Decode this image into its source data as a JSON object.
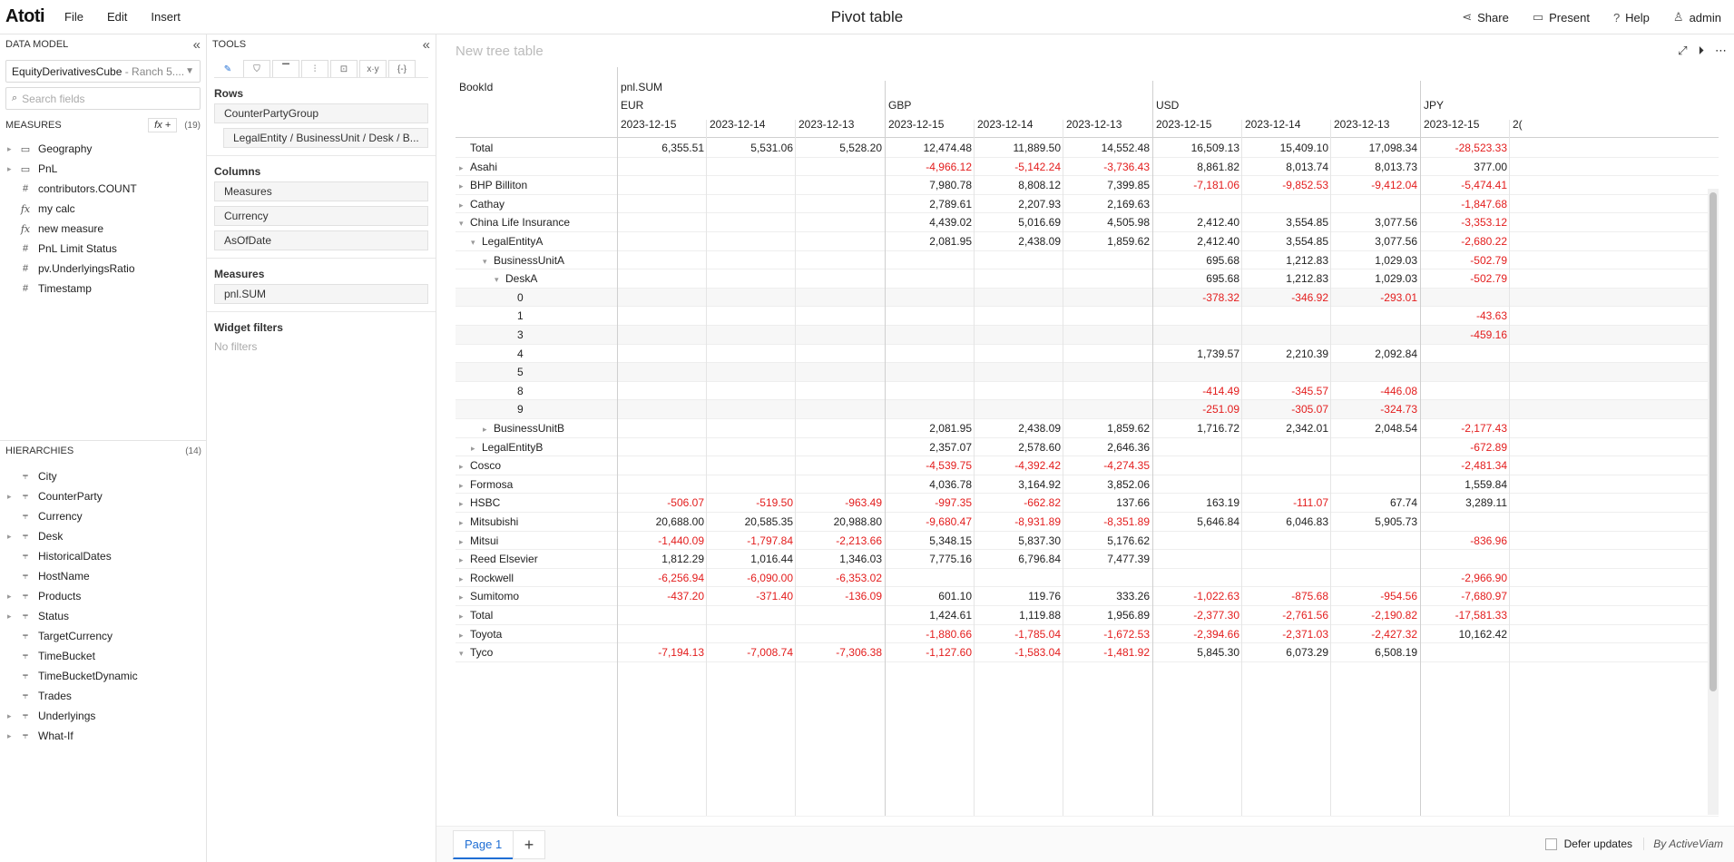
{
  "app": {
    "logo": "Atoti",
    "menu": [
      "File",
      "Edit",
      "Insert"
    ],
    "title": "Pivot table",
    "actions": [
      {
        "label": "Share",
        "icon": "share-icon"
      },
      {
        "label": "Present",
        "icon": "monitor-icon"
      },
      {
        "label": "Help",
        "icon": "help-icon"
      },
      {
        "label": "admin",
        "icon": "user-icon"
      }
    ]
  },
  "data_model": {
    "header": "DATA MODEL",
    "cube": "EquityDerivativesCube",
    "cube_suffix": " - Ranch 5....",
    "search_placeholder": "Search fields",
    "measures_header": "MEASURES",
    "measures_fx": "fx",
    "measures_count": "(19)",
    "measures": [
      {
        "label": "Geography",
        "icon": "folder-icon",
        "caret": true
      },
      {
        "label": "PnL",
        "icon": "folder-icon",
        "caret": true
      },
      {
        "label": "contributors.COUNT",
        "icon": "hash-icon"
      },
      {
        "label": "my calc",
        "icon": "fx-icon"
      },
      {
        "label": "new measure",
        "icon": "fx-icon"
      },
      {
        "label": "PnL Limit Status",
        "icon": "hash-icon"
      },
      {
        "label": "pv.UnderlyingsRatio",
        "icon": "hash-icon"
      },
      {
        "label": "Timestamp",
        "icon": "hash-icon"
      }
    ],
    "hierarchies_header": "HIERARCHIES",
    "hierarchies_count": "(14)",
    "hierarchies": [
      {
        "label": "City",
        "caret": false
      },
      {
        "label": "CounterParty",
        "caret": true
      },
      {
        "label": "Currency",
        "caret": false
      },
      {
        "label": "Desk",
        "caret": true
      },
      {
        "label": "HistoricalDates",
        "caret": false
      },
      {
        "label": "HostName",
        "caret": false
      },
      {
        "label": "Products",
        "caret": true
      },
      {
        "label": "Status",
        "caret": true
      },
      {
        "label": "TargetCurrency",
        "caret": false
      },
      {
        "label": "TimeBucket",
        "caret": false
      },
      {
        "label": "TimeBucketDynamic",
        "caret": false
      },
      {
        "label": "Trades",
        "caret": false
      },
      {
        "label": "Underlyings",
        "caret": true
      },
      {
        "label": "What-If",
        "caret": true
      }
    ]
  },
  "tools": {
    "header": "TOOLS",
    "tabs": [
      "pencil-icon",
      "filter-icon",
      "paint-roller-icon",
      "sliders-icon",
      "formula-icon",
      "xy-icon",
      "braces-icon"
    ],
    "tab_glyphs": [
      "✎",
      "⛉",
      "▔",
      "⫶",
      "⊡",
      "x·y",
      "{-}"
    ],
    "rows_title": "Rows",
    "rows": [
      "CounterPartyGroup",
      "LegalEntity / BusinessUnit / Desk / B..."
    ],
    "columns_title": "Columns",
    "columns": [
      "Measures",
      "Currency",
      "AsOfDate"
    ],
    "measures_title": "Measures",
    "measures": [
      "pnl.SUM"
    ],
    "filters_title": "Widget filters",
    "filters_empty": "No filters"
  },
  "widget": {
    "title": "New tree table",
    "row_header": "BookId",
    "measure": "pnl.SUM",
    "currencies": [
      "EUR",
      "GBP",
      "USD",
      "JPY"
    ],
    "dates": [
      "2023-12-15",
      "2023-12-14",
      "2023-12-13",
      "2023-12-15",
      "2023-12-14",
      "2023-12-13",
      "2023-12-15",
      "2023-12-14",
      "2023-12-13",
      "2023-12-15",
      "2("
    ],
    "rows": [
      {
        "label": "Total",
        "level": 0,
        "toggle": "",
        "values": [
          "6,355.51",
          "5,531.06",
          "5,528.20",
          "12,474.48",
          "11,889.50",
          "14,552.48",
          "16,509.13",
          "15,409.10",
          "17,098.34",
          "-28,523.33"
        ]
      },
      {
        "label": "Asahi",
        "level": 0,
        "toggle": "▸",
        "values": [
          "",
          "",
          "",
          "-4,966.12",
          "-5,142.24",
          "-3,736.43",
          "8,861.82",
          "8,013.74",
          "8,013.73",
          "377.00"
        ]
      },
      {
        "label": "BHP Billiton",
        "level": 0,
        "toggle": "▸",
        "values": [
          "",
          "",
          "",
          "7,980.78",
          "8,808.12",
          "7,399.85",
          "-7,181.06",
          "-9,852.53",
          "-9,412.04",
          "-5,474.41"
        ]
      },
      {
        "label": "Cathay",
        "level": 0,
        "toggle": "▸",
        "values": [
          "",
          "",
          "",
          "2,789.61",
          "2,207.93",
          "2,169.63",
          "",
          "",
          "",
          "-1,847.68"
        ]
      },
      {
        "label": "China Life Insurance",
        "level": 0,
        "toggle": "▾",
        "values": [
          "",
          "",
          "",
          "4,439.02",
          "5,016.69",
          "4,505.98",
          "2,412.40",
          "3,554.85",
          "3,077.56",
          "-3,353.12"
        ]
      },
      {
        "label": "LegalEntityA",
        "level": 1,
        "toggle": "▾",
        "values": [
          "",
          "",
          "",
          "2,081.95",
          "2,438.09",
          "1,859.62",
          "2,412.40",
          "3,554.85",
          "3,077.56",
          "-2,680.22"
        ]
      },
      {
        "label": "BusinessUnitA",
        "level": 2,
        "toggle": "▾",
        "values": [
          "",
          "",
          "",
          "",
          "",
          "",
          "695.68",
          "1,212.83",
          "1,029.03",
          "-502.79"
        ]
      },
      {
        "label": "DeskA",
        "level": 3,
        "toggle": "▾",
        "values": [
          "",
          "",
          "",
          "",
          "",
          "",
          "695.68",
          "1,212.83",
          "1,029.03",
          "-502.79"
        ]
      },
      {
        "label": "0",
        "level": 4,
        "toggle": "",
        "values": [
          "",
          "",
          "",
          "",
          "",
          "",
          "-378.32",
          "-346.92",
          "-293.01",
          ""
        ]
      },
      {
        "label": "1",
        "level": 4,
        "toggle": "",
        "values": [
          "",
          "",
          "",
          "",
          "",
          "",
          "",
          "",
          "",
          "-43.63"
        ]
      },
      {
        "label": "3",
        "level": 4,
        "toggle": "",
        "values": [
          "",
          "",
          "",
          "",
          "",
          "",
          "",
          "",
          "",
          "-459.16"
        ]
      },
      {
        "label": "4",
        "level": 4,
        "toggle": "",
        "values": [
          "",
          "",
          "",
          "",
          "",
          "",
          "1,739.57",
          "2,210.39",
          "2,092.84",
          ""
        ]
      },
      {
        "label": "5",
        "level": 4,
        "toggle": "",
        "values": [
          "",
          "",
          "",
          "",
          "",
          "",
          "",
          "",
          "",
          ""
        ]
      },
      {
        "label": "8",
        "level": 4,
        "toggle": "",
        "values": [
          "",
          "",
          "",
          "",
          "",
          "",
          "-414.49",
          "-345.57",
          "-446.08",
          ""
        ]
      },
      {
        "label": "9",
        "level": 4,
        "toggle": "",
        "values": [
          "",
          "",
          "",
          "",
          "",
          "",
          "-251.09",
          "-305.07",
          "-324.73",
          ""
        ]
      },
      {
        "label": "BusinessUnitB",
        "level": 2,
        "toggle": "▸",
        "values": [
          "",
          "",
          "",
          "2,081.95",
          "2,438.09",
          "1,859.62",
          "1,716.72",
          "2,342.01",
          "2,048.54",
          "-2,177.43"
        ]
      },
      {
        "label": "LegalEntityB",
        "level": 1,
        "toggle": "▸",
        "values": [
          "",
          "",
          "",
          "2,357.07",
          "2,578.60",
          "2,646.36",
          "",
          "",
          "",
          "-672.89"
        ]
      },
      {
        "label": "Cosco",
        "level": 0,
        "toggle": "▸",
        "values": [
          "",
          "",
          "",
          "-4,539.75",
          "-4,392.42",
          "-4,274.35",
          "",
          "",
          "",
          "-2,481.34"
        ]
      },
      {
        "label": "Formosa",
        "level": 0,
        "toggle": "▸",
        "values": [
          "",
          "",
          "",
          "4,036.78",
          "3,164.92",
          "3,852.06",
          "",
          "",
          "",
          "1,559.84"
        ]
      },
      {
        "label": "HSBC",
        "level": 0,
        "toggle": "▸",
        "values": [
          "-506.07",
          "-519.50",
          "-963.49",
          "-997.35",
          "-662.82",
          "137.66",
          "163.19",
          "-111.07",
          "67.74",
          "3,289.11"
        ]
      },
      {
        "label": "Mitsubishi",
        "level": 0,
        "toggle": "▸",
        "values": [
          "20,688.00",
          "20,585.35",
          "20,988.80",
          "-9,680.47",
          "-8,931.89",
          "-8,351.89",
          "5,646.84",
          "6,046.83",
          "5,905.73",
          ""
        ]
      },
      {
        "label": "Mitsui",
        "level": 0,
        "toggle": "▸",
        "values": [
          "-1,440.09",
          "-1,797.84",
          "-2,213.66",
          "5,348.15",
          "5,837.30",
          "5,176.62",
          "",
          "",
          "",
          "-836.96"
        ]
      },
      {
        "label": "Reed Elsevier",
        "level": 0,
        "toggle": "▸",
        "values": [
          "1,812.29",
          "1,016.44",
          "1,346.03",
          "7,775.16",
          "6,796.84",
          "7,477.39",
          "",
          "",
          "",
          ""
        ]
      },
      {
        "label": "Rockwell",
        "level": 0,
        "toggle": "▸",
        "values": [
          "-6,256.94",
          "-6,090.00",
          "-6,353.02",
          "",
          "",
          "",
          "",
          "",
          "",
          "-2,966.90"
        ]
      },
      {
        "label": "Sumitomo",
        "level": 0,
        "toggle": "▸",
        "values": [
          "-437.20",
          "-371.40",
          "-136.09",
          "601.10",
          "119.76",
          "333.26",
          "-1,022.63",
          "-875.68",
          "-954.56",
          "-7,680.97"
        ]
      },
      {
        "label": "Total",
        "level": 0,
        "toggle": "▸",
        "values": [
          "",
          "",
          "",
          "1,424.61",
          "1,119.88",
          "1,956.89",
          "-2,377.30",
          "-2,761.56",
          "-2,190.82",
          "-17,581.33"
        ]
      },
      {
        "label": "Toyota",
        "level": 0,
        "toggle": "▸",
        "values": [
          "",
          "",
          "",
          "-1,880.66",
          "-1,785.04",
          "-1,672.53",
          "-2,394.66",
          "-2,371.03",
          "-2,427.32",
          "10,162.42"
        ]
      },
      {
        "label": "Tyco",
        "level": 0,
        "toggle": "▾",
        "values": [
          "-7,194.13",
          "-7,008.74",
          "-7,306.38",
          "-1,127.60",
          "-1,583.04",
          "-1,481.92",
          "5,845.30",
          "6,073.29",
          "6,508.19",
          ""
        ]
      }
    ]
  },
  "footer": {
    "page_tab": "Page 1",
    "add_page": "+",
    "defer_label": "Defer updates",
    "byline": "By ActiveViam"
  }
}
